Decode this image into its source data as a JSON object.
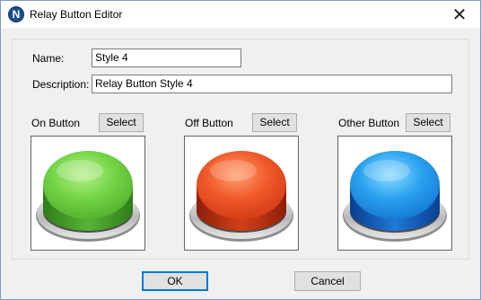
{
  "window": {
    "title": "Relay Button Editor",
    "app_icon_letter": "N",
    "close_glyph": "✕"
  },
  "form": {
    "name_label": "Name:",
    "name_value": "Style 4",
    "description_label": "Description:",
    "description_value": "Relay Button Style 4"
  },
  "buttons_section": [
    {
      "label": "On Button",
      "select_label": "Select",
      "color": "#5fc63a",
      "icon": "green-relay-button-icon"
    },
    {
      "label": "Off Button",
      "select_label": "Select",
      "color": "#e8461f",
      "icon": "red-relay-button-icon"
    },
    {
      "label": "Other Button",
      "select_label": "Select",
      "color": "#1e90e8",
      "icon": "blue-relay-button-icon"
    }
  ],
  "footer": {
    "ok_label": "OK",
    "cancel_label": "Cancel"
  },
  "colors": {
    "accent": "#0078d7",
    "window_bg": "#f0f0f0"
  }
}
